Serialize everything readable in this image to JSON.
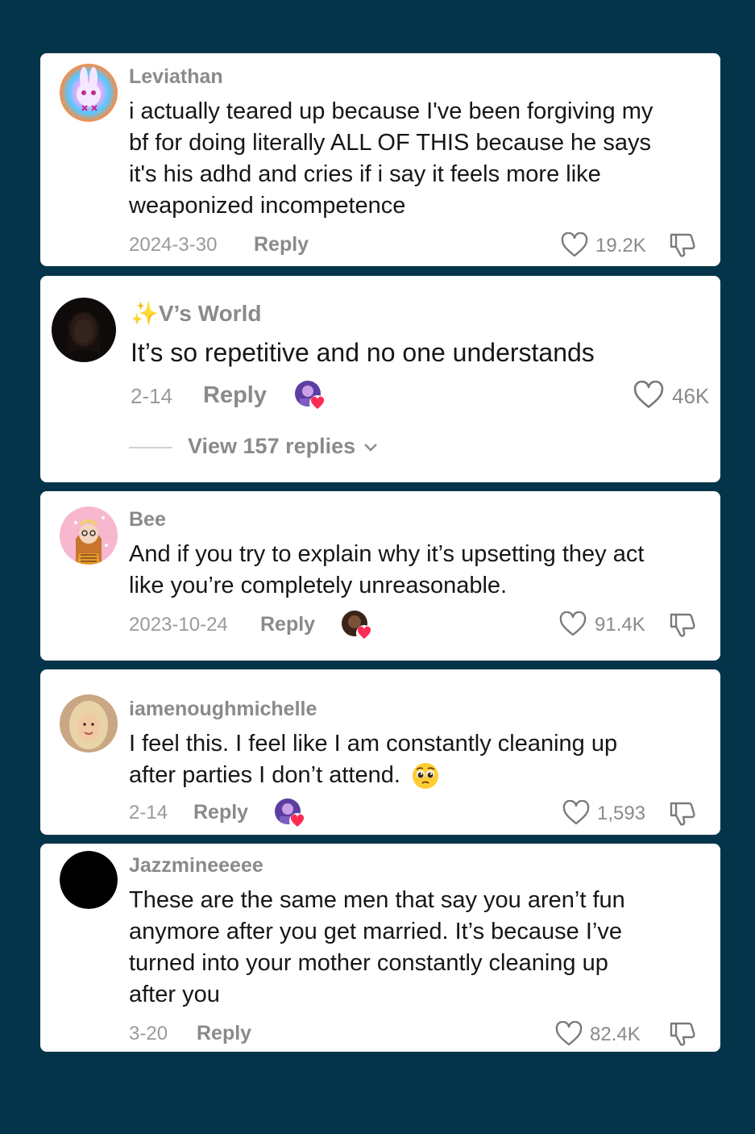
{
  "colors": {
    "background": "#04344a",
    "card": "#ffffff",
    "heart": "#fe2c55"
  },
  "comments": [
    {
      "username": "Leviathan",
      "lines": [
        "i actually teared up because I've been forgiving my",
        "bf for doing literally ALL OF THIS because he says",
        "it's his adhd and cries if i say it feels more like",
        "weaponized incompetence"
      ],
      "date": "2024-3-30",
      "reply_label": "Reply",
      "likes": "19.2K",
      "avatar_icon": "rabbit-art-avatar"
    },
    {
      "username": "V’s World",
      "username_prefix": "✨",
      "lines": [
        "It’s so repetitive and no one understands"
      ],
      "date": "2-14",
      "reply_label": "Reply",
      "likes": "46K",
      "view_replies": "View 157 replies",
      "creator_liked": true,
      "avatar_icon": "dark-portrait-avatar"
    },
    {
      "username": "Bee",
      "lines": [
        "And if you try to explain why it’s upsetting they act",
        "like you’re completely unreasonable."
      ],
      "date": "2023-10-24",
      "reply_label": "Reply",
      "likes": "91.4K",
      "creator_liked": true,
      "avatar_icon": "cartoon-girl-avatar"
    },
    {
      "username": "iamenoughmichelle",
      "lines": [
        "I feel this. I feel like I am constantly cleaning up",
        "after parties I don’t attend."
      ],
      "emoji": "pleading-face-emoji",
      "date": "2-14",
      "reply_label": "Reply",
      "likes": "1,593",
      "creator_liked": true,
      "avatar_icon": "blonde-woman-avatar"
    },
    {
      "username": "Jazzmineeeee",
      "lines": [
        "These are the same men that say you aren’t fun",
        "anymore after you get married. It’s because I’ve",
        "turned into your mother constantly cleaning up",
        "after you"
      ],
      "date": "3-20",
      "reply_label": "Reply",
      "likes": "82.4K",
      "avatar_icon": "black-circle-avatar"
    }
  ]
}
